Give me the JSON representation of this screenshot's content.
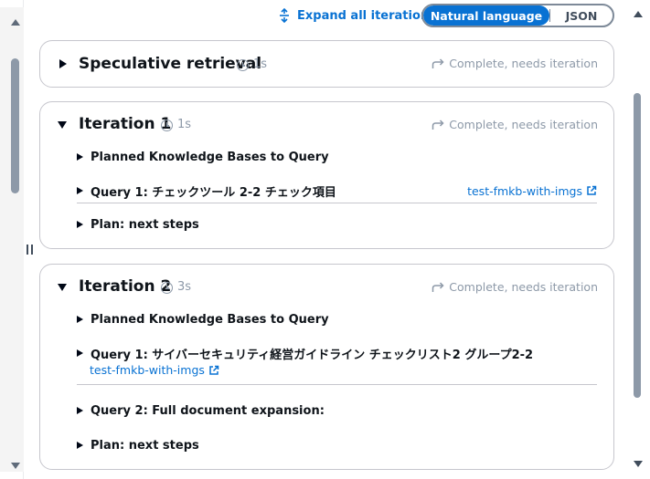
{
  "toolbar": {
    "expand_all_label": "Expand all iterations",
    "mode_options": [
      "Natural language",
      "JSON"
    ],
    "selected_mode": "Natural language"
  },
  "cards": [
    {
      "title": "Speculative retrieval",
      "duration": "1s",
      "status": "Complete, needs iteration",
      "expanded": false
    },
    {
      "title": "Iteration 1",
      "duration": "1s",
      "status": "Complete, needs iteration",
      "expanded": true,
      "rows": [
        {
          "label": "Planned Knowledge Bases to Query"
        },
        {
          "label": "Query 1: チェックツール 2-2 チェック項目",
          "link": "test-fmkb-with-imgs"
        },
        {
          "label": "Plan: next steps"
        }
      ]
    },
    {
      "title": "Iteration 2",
      "duration": "3s",
      "status": "Complete, needs iteration",
      "expanded": true,
      "rows": [
        {
          "label": "Planned Knowledge Bases to Query"
        },
        {
          "label": "Query 1: サイバーセキュリティ経営ガイドライン チェックリスト2 グループ2-2",
          "link": "test-fmkb-with-imgs"
        },
        {
          "label": "Query 2: Full document expansion:"
        },
        {
          "label": "Plan: next steps"
        }
      ]
    }
  ],
  "colors": {
    "link": "#0972d3",
    "status": "#8d99a8",
    "border": "#c6c6cd",
    "text": "#0f141a"
  }
}
